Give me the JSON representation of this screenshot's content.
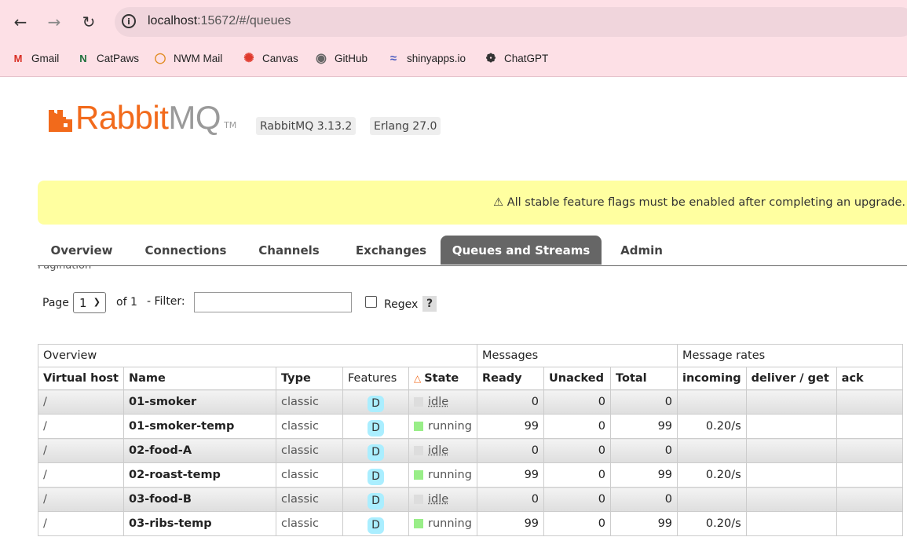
{
  "browser": {
    "url_host": "localhost",
    "url_path": ":15672/#/queues",
    "bookmarks": [
      {
        "label": "Gmail",
        "icon": "gmail-icon"
      },
      {
        "label": "CatPaws",
        "icon": "catpaws-icon"
      },
      {
        "label": "NWM Mail",
        "icon": "nwm-mail-icon"
      },
      {
        "label": "Canvas",
        "icon": "canvas-icon"
      },
      {
        "label": "GitHub",
        "icon": "github-icon"
      },
      {
        "label": "shinyapps.io",
        "icon": "shinyapps-icon"
      },
      {
        "label": "ChatGPT",
        "icon": "chatgpt-icon"
      }
    ]
  },
  "header": {
    "logo_rabbit": "Rabbit",
    "logo_mq": "MQ",
    "logo_tm": "TM",
    "rabbitmq_version": "RabbitMQ 3.13.2",
    "erlang_version": "Erlang 27.0"
  },
  "warning": "⚠ All stable feature flags must be enabled after completing an upgrade.",
  "tabs": [
    "Overview",
    "Connections",
    "Channels",
    "Exchanges",
    "Queues and Streams",
    "Admin"
  ],
  "active_tab": "Queues and Streams",
  "pagination": {
    "section_label": "Pagination",
    "page_label": "Page",
    "page_value": "1",
    "of_label": "of 1",
    "filter_label": "- Filter:",
    "filter_value": "",
    "regex_label": "Regex",
    "help_label": "?"
  },
  "table": {
    "groups": [
      "Overview",
      "Messages",
      "Message rates"
    ],
    "columns": [
      "Virtual host",
      "Name",
      "Type",
      "Features",
      "State",
      "Ready",
      "Unacked",
      "Total",
      "incoming",
      "deliver / get",
      "ack"
    ],
    "rows": [
      {
        "vhost": "/",
        "name": "01-smoker",
        "type": "classic",
        "feature": "D",
        "state": "idle",
        "ready": "0",
        "unacked": "0",
        "total": "0",
        "incoming": "",
        "deliver": "",
        "ack": ""
      },
      {
        "vhost": "/",
        "name": "01-smoker-temp",
        "type": "classic",
        "feature": "D",
        "state": "running",
        "ready": "99",
        "unacked": "0",
        "total": "99",
        "incoming": "0.20/s",
        "deliver": "",
        "ack": ""
      },
      {
        "vhost": "/",
        "name": "02-food-A",
        "type": "classic",
        "feature": "D",
        "state": "idle",
        "ready": "0",
        "unacked": "0",
        "total": "0",
        "incoming": "",
        "deliver": "",
        "ack": ""
      },
      {
        "vhost": "/",
        "name": "02-roast-temp",
        "type": "classic",
        "feature": "D",
        "state": "running",
        "ready": "99",
        "unacked": "0",
        "total": "99",
        "incoming": "0.20/s",
        "deliver": "",
        "ack": ""
      },
      {
        "vhost": "/",
        "name": "03-food-B",
        "type": "classic",
        "feature": "D",
        "state": "idle",
        "ready": "0",
        "unacked": "0",
        "total": "0",
        "incoming": "",
        "deliver": "",
        "ack": ""
      },
      {
        "vhost": "/",
        "name": "03-ribs-temp",
        "type": "classic",
        "feature": "D",
        "state": "running",
        "ready": "99",
        "unacked": "0",
        "total": "99",
        "incoming": "0.20/s",
        "deliver": "",
        "ack": ""
      }
    ]
  },
  "colors": {
    "brand_orange": "#f26a1b",
    "running": "#99ee88",
    "idle": "#dddddd",
    "feature_badge": "#aaeeff",
    "warning_bg": "#ffffa0",
    "active_tab": "#666666"
  }
}
